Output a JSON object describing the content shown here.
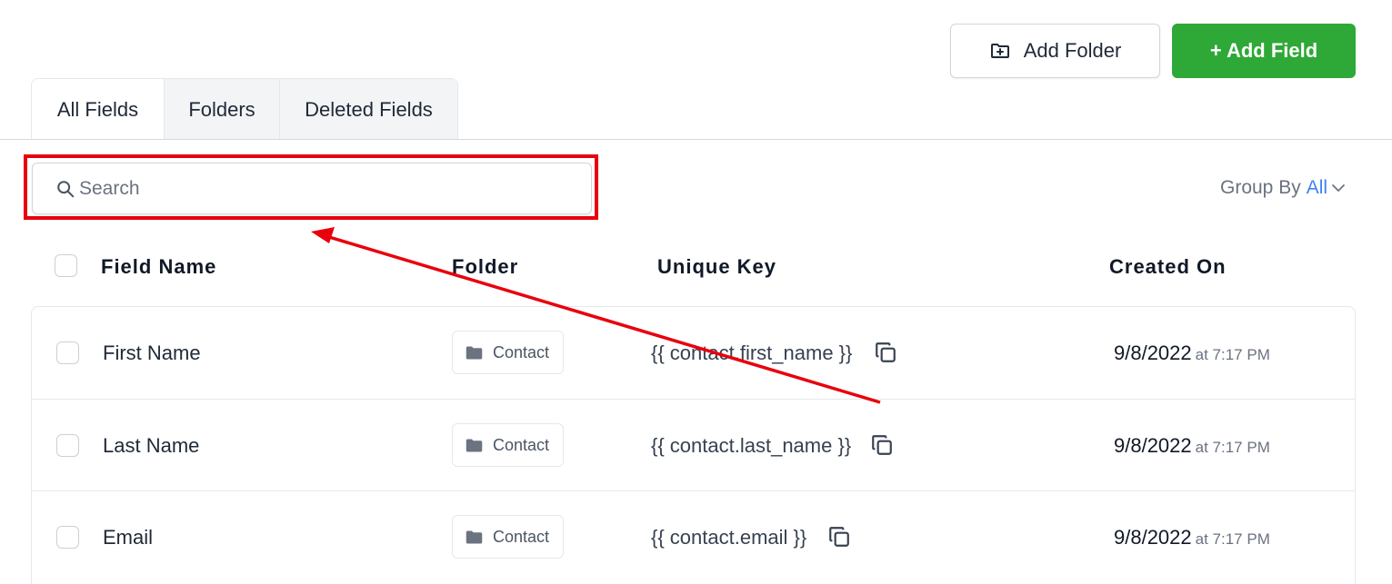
{
  "toolbar": {
    "add_folder_label": "Add Folder",
    "add_field_label": "+ Add Field"
  },
  "tabs": [
    {
      "label": "All Fields",
      "active": true
    },
    {
      "label": "Folders",
      "active": false
    },
    {
      "label": "Deleted Fields",
      "active": false
    }
  ],
  "search": {
    "placeholder": "Search",
    "value": ""
  },
  "group_by": {
    "label": "Group By",
    "value": "All"
  },
  "table": {
    "headers": {
      "field_name": "Field Name",
      "folder": "Folder",
      "unique_key": "Unique Key",
      "created_on": "Created On"
    },
    "rows": [
      {
        "name": "First Name",
        "folder": "Contact",
        "key": "{{ contact.first_name }}",
        "date": "9/8/2022",
        "time": "at 7:17 PM"
      },
      {
        "name": "Last Name",
        "folder": "Contact",
        "key": "{{ contact.last_name }}",
        "date": "9/8/2022",
        "time": "at 7:17 PM"
      },
      {
        "name": "Email",
        "folder": "Contact",
        "key": "{{ contact.email }}",
        "date": "9/8/2022",
        "time": "at 7:17 PM"
      }
    ]
  },
  "colors": {
    "primary_green": "#2ea836",
    "annotation_red": "#e8000d",
    "link_blue": "#3b82f6"
  },
  "icons": {
    "add_folder": "folder-plus-icon",
    "search": "search-icon",
    "group_by": "chevron-down-icon",
    "folder": "folder-icon",
    "copy": "copy-icon"
  }
}
